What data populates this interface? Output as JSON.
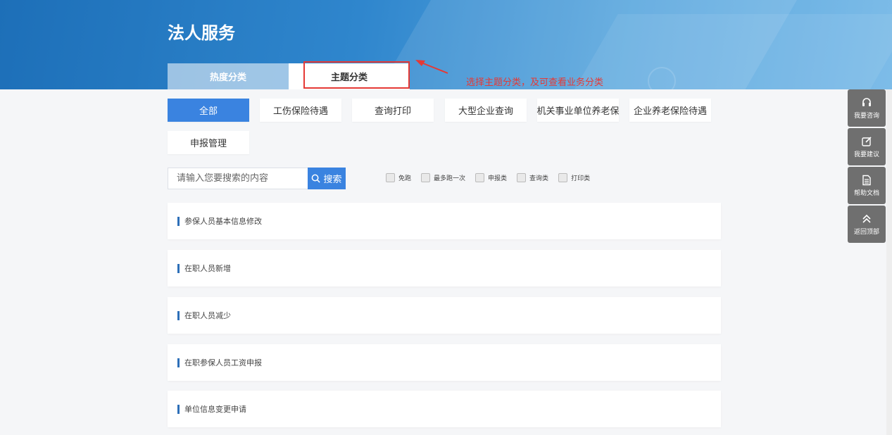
{
  "header": {
    "title": "法人服务"
  },
  "tabs": [
    {
      "label": "热度分类"
    },
    {
      "label": "主题分类"
    }
  ],
  "annotation": {
    "text": "选择主题分类，及可查看业务分类",
    "color": "#e53935"
  },
  "categories": [
    {
      "label": "全部",
      "active": true
    },
    {
      "label": "工伤保险待遇"
    },
    {
      "label": "查询打印"
    },
    {
      "label": "大型企业查询"
    },
    {
      "label": "机关事业单位养老保"
    },
    {
      "label": "企业养老保险待遇"
    },
    {
      "label": "申报管理"
    }
  ],
  "search": {
    "placeholder": "请输入您要搜索的内容",
    "button_label": "搜索"
  },
  "filters": [
    {
      "label": "免跑"
    },
    {
      "label": "最多跑一次"
    },
    {
      "label": "申报类"
    },
    {
      "label": "查询类"
    },
    {
      "label": "打印类"
    }
  ],
  "list_items": [
    {
      "label": "参保人员基本信息修改"
    },
    {
      "label": "在职人员新增"
    },
    {
      "label": "在职人员减少"
    },
    {
      "label": "在职参保人员工资申报"
    },
    {
      "label": "单位信息变更申请"
    }
  ],
  "side_panel": [
    {
      "label": "我要咨询",
      "icon": "headset-icon"
    },
    {
      "label": "我要建议",
      "icon": "edit-icon"
    },
    {
      "label": "帮助文档",
      "icon": "document-icon"
    },
    {
      "label": "返回顶部",
      "icon": "chevron-up-double-icon"
    }
  ],
  "colors": {
    "primary": "#3a83e0",
    "banner": "#2f86cd",
    "accent_bar": "#2d6fb8",
    "side_panel": "#6f6f6f"
  }
}
